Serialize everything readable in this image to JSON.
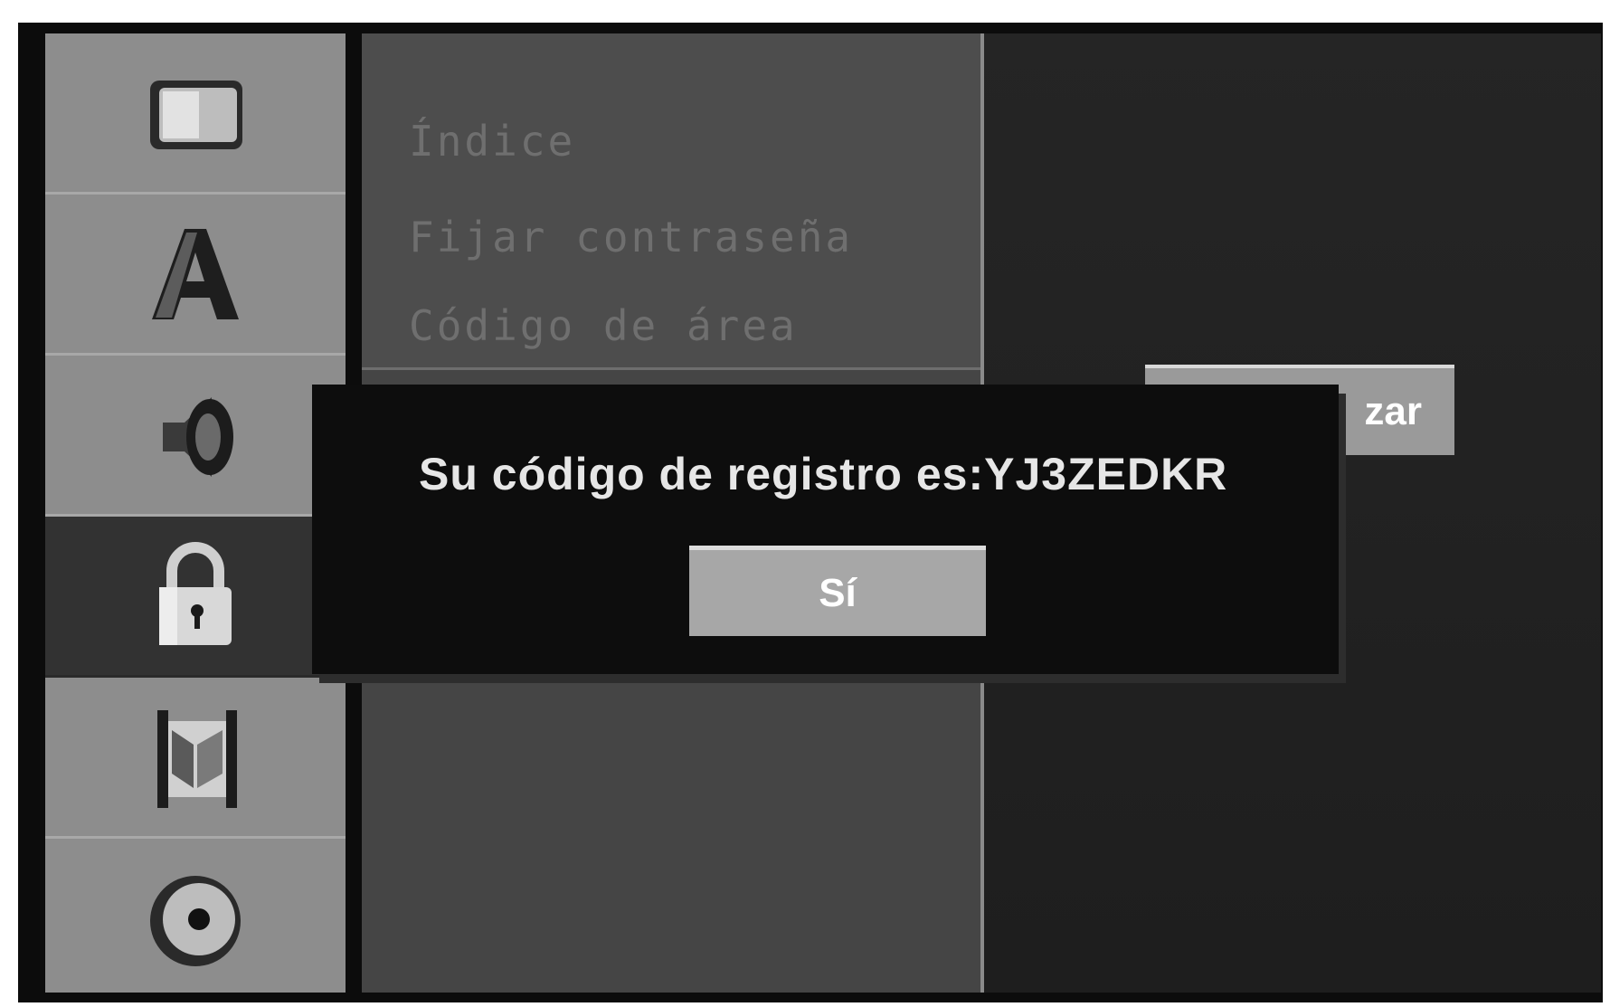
{
  "sidebar": {
    "items": [
      {
        "icon": "tv-screen-icon"
      },
      {
        "icon": "language-a-icon"
      },
      {
        "icon": "speaker-icon"
      },
      {
        "icon": "lock-icon",
        "active": true
      },
      {
        "icon": "film-strip-icon"
      },
      {
        "icon": "disc-icon"
      }
    ]
  },
  "submenu": {
    "items": [
      "Índice",
      "Fijar contraseña",
      "Código de área"
    ]
  },
  "right_panel": {
    "button_partial_label": "zar"
  },
  "dialog": {
    "message": "Su código de registro es:YJ3ZEDKR",
    "button_label": "Sí"
  }
}
